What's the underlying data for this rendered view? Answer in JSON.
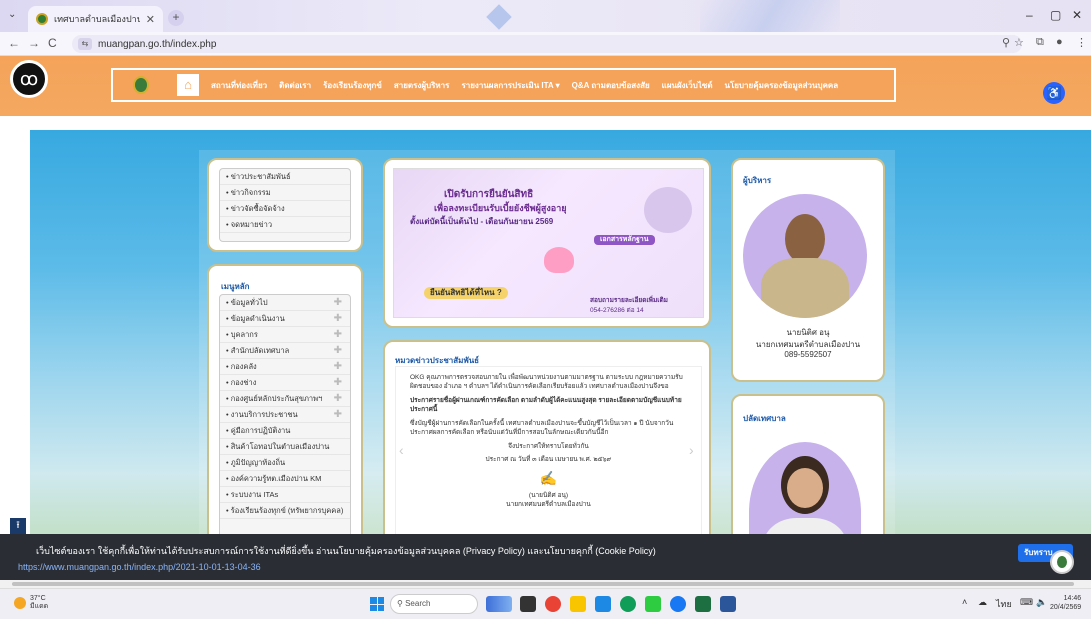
{
  "browser": {
    "tab_title": "เทศบาลตำบลเมืองปาน จ.ลำปาง",
    "url": "muangpan.go.th/index.php",
    "window_controls": [
      "–",
      "▢",
      "✕"
    ]
  },
  "site": {
    "nav": [
      "สถานที่ท่องเที่ยว",
      "ติดต่อเรา",
      "ร้องเรียนร้องทุกข์",
      "สายตรงผู้บริหาร",
      "รายงานผลการประเมิน ITA ▾",
      "Q&A ถามตอบข้อสงสัย",
      "แผนผังเว็บไซต์",
      "นโยบายคุ้มครองข้อมูลส่วนบุคคล"
    ]
  },
  "left_top_list": [
    "ข่าวประชาสัมพันธ์",
    "ข่าวกิจกรรม",
    "ข่าวจัดซื้อจัดจ้าง",
    "จดหมายข่าว"
  ],
  "main_menu": {
    "title": "เมนูหลัก",
    "items": [
      "ข้อมูลทั่วไป",
      "ข้อมูลดำเนินงาน",
      "บุคลากร",
      "สำนักปลัดเทศบาล",
      "กองคลัง",
      "กองช่าง",
      "กองศูนย์หลักประกันสุขภาพฯ",
      "งานบริการประชาชน",
      "คู่มือการปฏิบัติงาน",
      "สินค้าโอทอปในตำบลเมืองปาน",
      "ภูมิปัญญาท้องถิ่น",
      "องค์ความรู้ทต.เมืองปาน KM",
      "ระบบงาน ITAs",
      "ร้องเรียนร้องทุกข์ (ทรัพยากรบุคคล)"
    ]
  },
  "poster": {
    "headline": "เปิดรับการยืนยันสิทธิ",
    "subhead": "เพื่อลงทะเบียนรับเบี้ยยังชีพผู้สูงอายุ",
    "period": "ตั้งแต่บัดนี้เป็นต้นไป - เดือนกันยายน 2569",
    "question": "ยืนยันสิทธิได้ที่ไหน ?",
    "docs": "เอกสารหลักฐาน",
    "contact": "สอบถามรายละเอียดเพิ่มเติม",
    "phone": "054-276286 ต่อ 14"
  },
  "news": {
    "title": "หมวดข่าวประชาสัมพันธ์",
    "para1": "OKG คุณภาพการตรวจสอบภายใน เพื่อพัฒนาหน่วยงานตามมาตรฐาน ตามระบบ กฎหมายความรับผิดชอบของ อำเภอ ฯ ตำบลฯ ได้ดำเนินการคัดเลือกเรียบร้อยแล้ว เทศบาลตำบลเมืองปานจึงขอ",
    "para2": "ประกาศรายชื่อผู้ผ่านเกณฑ์การคัดเลือก ตามลำดับผู้ได้คะแนนสูงสุด รายละเอียดตามบัญชีแนบท้ายประกาศนี้",
    "para3": "ซึ่งบัญชีผู้ผ่านการคัดเลือกในครั้งนี้ เทศบาลตำบลเมืองปานจะขึ้นบัญชีไว้เป็นเวลา ๑ ปี นับจากวันประกาศผลการคัดเลือก หรือนับแต่วันที่มีการสอบในลักษณะเดียวกันนี้อีก",
    "announce": "จึงประกาศให้ทราบโดยทั่วกัน",
    "date": "ประกาศ ณ วันที่ ๓ เดือน เมษายน พ.ศ. ๒๕๖๙",
    "signer": "(นายนิติศ อนุ)",
    "signer_title": "นายกเทศมนตรีตำบลเมืองปาน"
  },
  "executives": {
    "title": "ผู้บริหาร",
    "name": "นายนิติศ อนุ",
    "position": "นายกเทศมนตรีตำบลเมืองปาน",
    "phone": "089-5592507",
    "deputy_title": "ปลัดเทศบาล"
  },
  "cookie": {
    "text": "เว็บไซต์ของเรา ใช้คุกกี้เพื่อให้ท่านได้รับประสบการณ์การใช้งานที่ดียิ่งขึ้น อ่านนโยบายคุ้มครองข้อมูลส่วนบุคคล (Privacy Policy) และนโยบายคุกกี้ (Cookie Policy)",
    "link_url": "https://www.muangpan.go.th/index.php/2021-10-01-13-04-36",
    "accept_label": "รับทราบ"
  },
  "taskbar": {
    "temp": "37°C",
    "condition": "มีแดด",
    "search": "Search",
    "lang": "ไทย",
    "time": "14:46",
    "date": "20/4/2569"
  },
  "colors": {
    "nav_orange": "#f5a35a",
    "panel_border": "#c9c08c",
    "link_blue": "#1e5aa8",
    "cookie_bg": "#2a2e34",
    "accept_blue": "#1f6feb"
  }
}
